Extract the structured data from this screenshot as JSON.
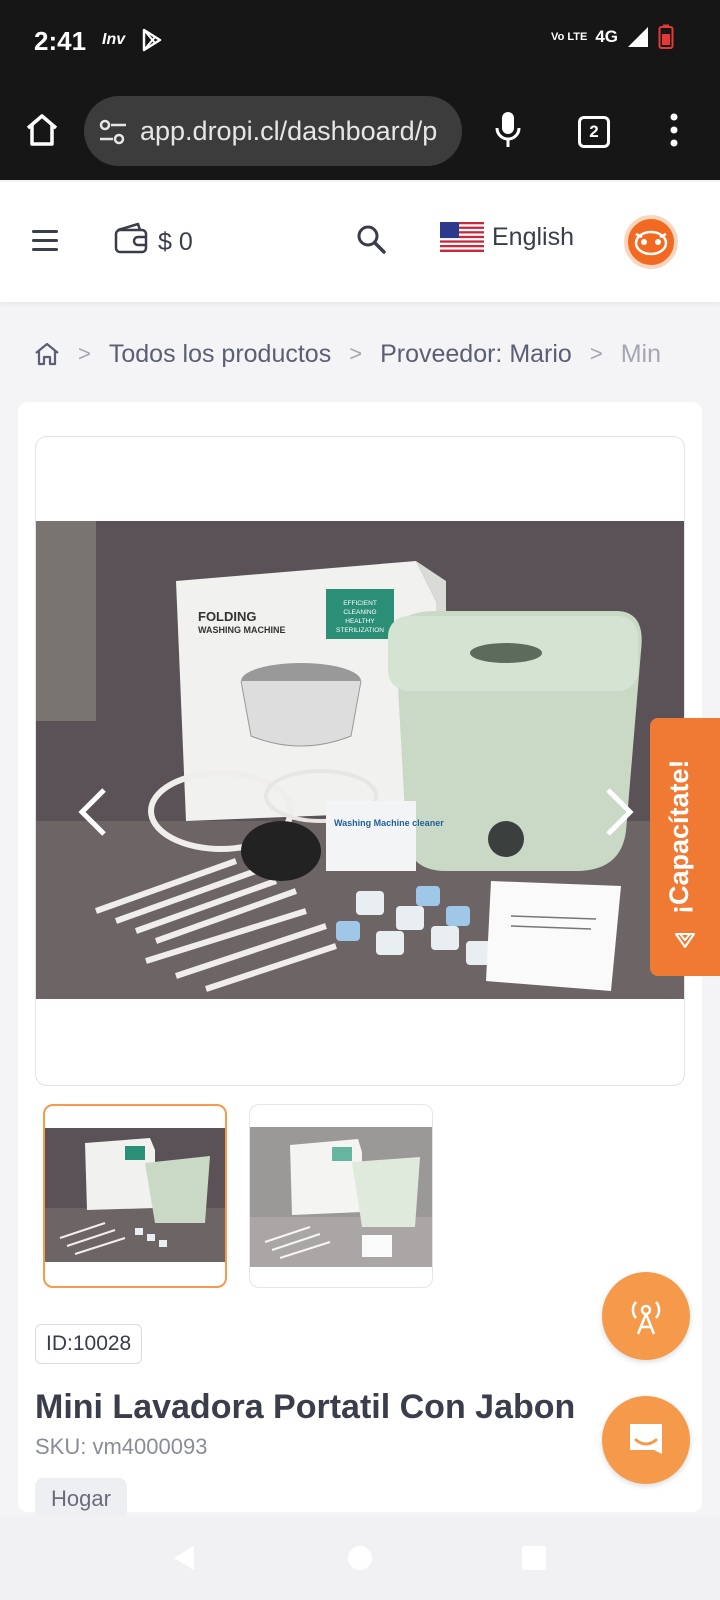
{
  "status_bar": {
    "time": "2:41",
    "left_icons": [
      "inv-icon",
      "play-store-icon"
    ],
    "carrier_badge": "Inv",
    "volte": "Vo LTE",
    "network": "4G",
    "battery_color": "#e53935"
  },
  "browser": {
    "url": "app.dropi.cl/dashboard/p",
    "tab_count": "2"
  },
  "header": {
    "balance": "$ 0",
    "language": "English",
    "accent": "#f26a21"
  },
  "breadcrumb": {
    "items": [
      "Todos los productos",
      "Proveedor: Mario",
      "Min"
    ]
  },
  "product": {
    "id_label": "ID:10028",
    "title": "Mini Lavadora Portatil Con Jabon",
    "sku": "SKU: vm4000093",
    "category": "Hogar",
    "image_box_text": [
      "FOLDING",
      "WASHING MACHINE",
      "EFFICIENT",
      "CLEANING",
      "HEALTHY",
      "STERILIZATION"
    ],
    "cleaner_label": "Washing Machine cleaner",
    "thumbnails": [
      "thumbnail-1",
      "thumbnail-2"
    ]
  },
  "floating": {
    "capacitate_label": "¡Capacítate!",
    "colors": {
      "capacitate": "#f07a34",
      "fab": "#f59a4a"
    }
  }
}
